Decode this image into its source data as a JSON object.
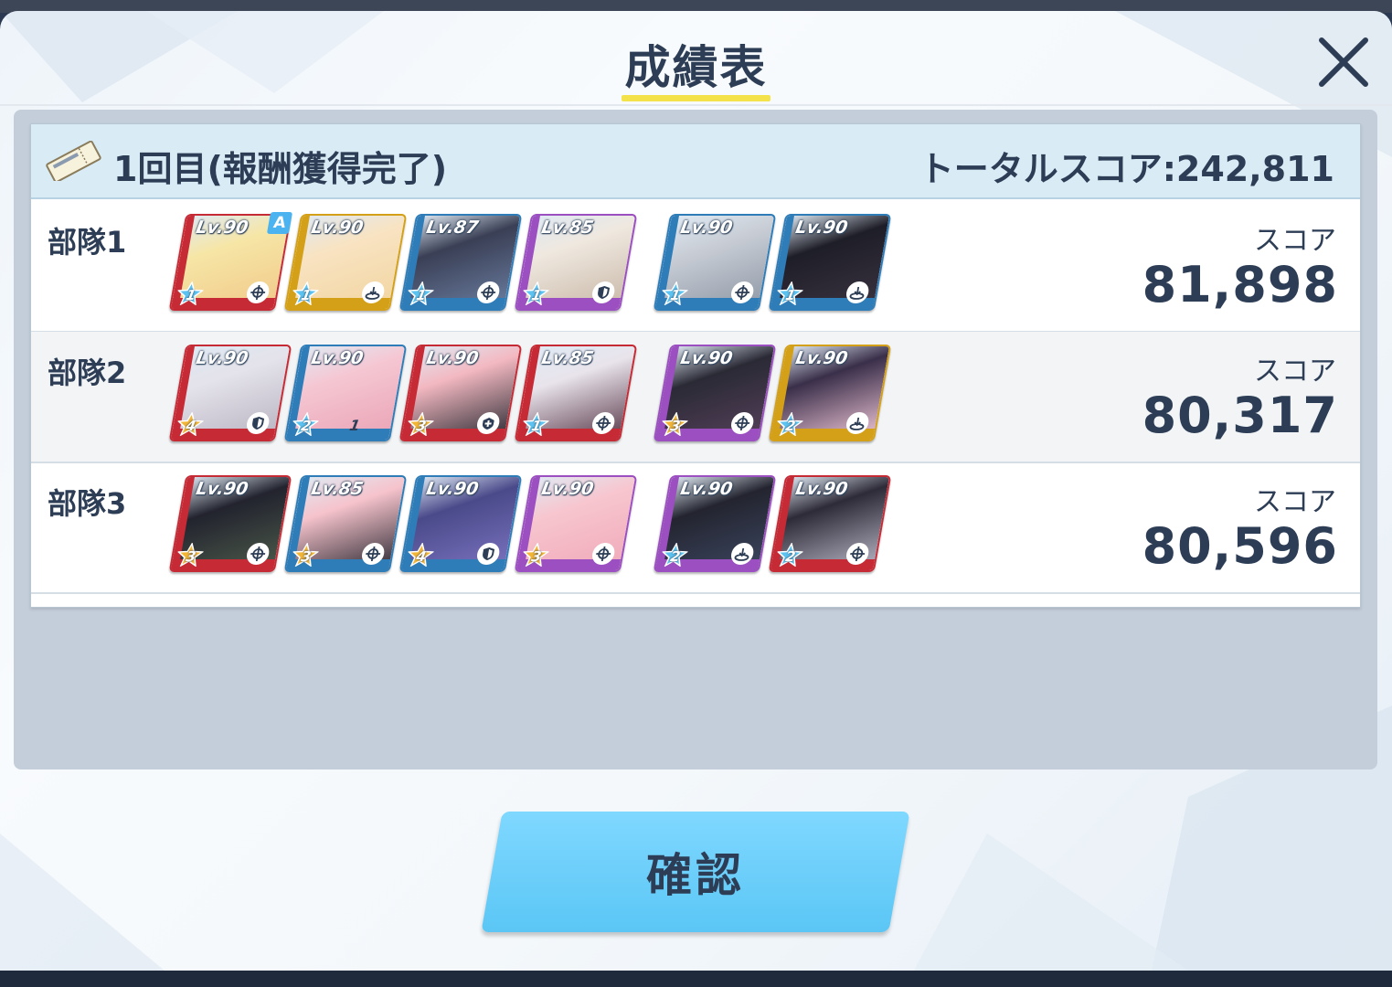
{
  "dialog": {
    "title": "成績表",
    "close_icon": "close-icon"
  },
  "round": {
    "label": "1回目(報酬獲得完了)",
    "total_score": "トータルスコア:242,811",
    "ticket_icon": "ticket-icon"
  },
  "teams": [
    {
      "name": "部隊1",
      "score_label": "スコア",
      "score": "81,898",
      "units": [
        {
          "level": "Lv.90",
          "star": "1",
          "role": "target",
          "color": "#c62a35",
          "assist": "A"
        },
        {
          "level": "Lv.90",
          "star": "1",
          "role": "ground",
          "color": "#d4a017"
        },
        {
          "level": "Lv.87",
          "star": "1",
          "role": "target",
          "color": "#2f7db8"
        },
        {
          "level": "Lv.85",
          "star": "1",
          "role": "shield",
          "color": "#9b4fc0"
        },
        {
          "level": "Lv.90",
          "star": "1",
          "role": "target",
          "color": "#2f7db8"
        },
        {
          "level": "Lv.90",
          "star": "1",
          "role": "ground",
          "color": "#2f7db8"
        }
      ]
    },
    {
      "name": "部隊2",
      "score_label": "スコア",
      "score": "80,317",
      "units": [
        {
          "level": "Lv.90",
          "star": "4",
          "role": "shield",
          "color": "#c62a35"
        },
        {
          "level": "Lv.90",
          "star": "2",
          "role": "none",
          "color": "#2f7db8",
          "extra": "1"
        },
        {
          "level": "Lv.90",
          "star": "3",
          "role": "heal",
          "color": "#c62a35"
        },
        {
          "level": "Lv.85",
          "star": "1",
          "role": "target",
          "color": "#c62a35"
        },
        {
          "level": "Lv.90",
          "star": "3",
          "role": "target",
          "color": "#9b4fc0"
        },
        {
          "level": "Lv.90",
          "star": "2",
          "role": "ground",
          "color": "#d4a017"
        }
      ]
    },
    {
      "name": "部隊3",
      "score_label": "スコア",
      "score": "80,596",
      "units": [
        {
          "level": "Lv.90",
          "star": "3",
          "role": "target",
          "color": "#c62a35"
        },
        {
          "level": "Lv.85",
          "star": "3",
          "role": "target",
          "color": "#2f7db8"
        },
        {
          "level": "Lv.90",
          "star": "4",
          "role": "shield",
          "color": "#2f7db8"
        },
        {
          "level": "Lv.90",
          "star": "3",
          "role": "target",
          "color": "#9b4fc0"
        },
        {
          "level": "Lv.90",
          "star": "2",
          "role": "ground",
          "color": "#9b4fc0"
        },
        {
          "level": "Lv.90",
          "star": "2",
          "role": "target",
          "color": "#c62a35"
        }
      ]
    }
  ],
  "confirm_button": {
    "label": "確認"
  },
  "colors": {
    "text_dark": "#2c3d55",
    "accent_yellow": "#f4e24a",
    "button_blue": "#5bc6f5",
    "header_bg": "#d9ecf5"
  }
}
